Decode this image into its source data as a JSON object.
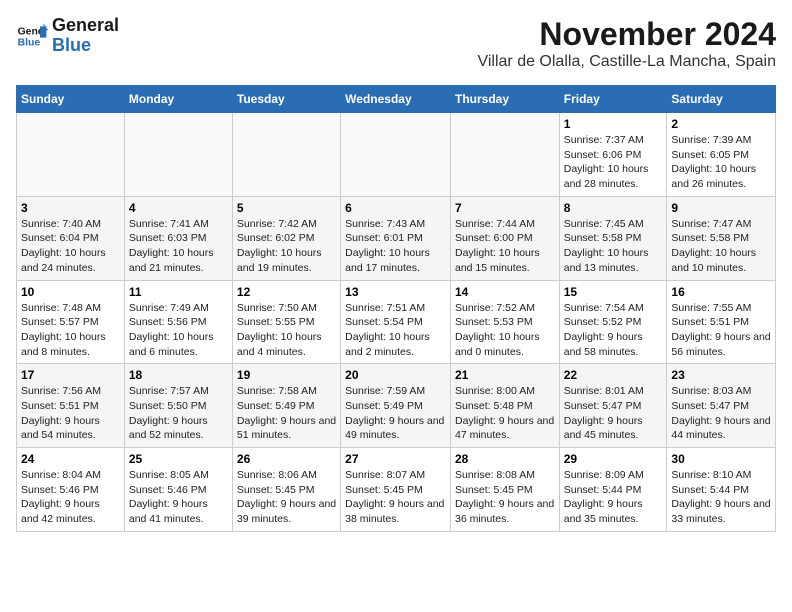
{
  "header": {
    "logo_line1": "General",
    "logo_line2": "Blue",
    "month": "November 2024",
    "location": "Villar de Olalla, Castille-La Mancha, Spain"
  },
  "weekdays": [
    "Sunday",
    "Monday",
    "Tuesday",
    "Wednesday",
    "Thursday",
    "Friday",
    "Saturday"
  ],
  "weeks": [
    [
      {
        "day": "",
        "info": ""
      },
      {
        "day": "",
        "info": ""
      },
      {
        "day": "",
        "info": ""
      },
      {
        "day": "",
        "info": ""
      },
      {
        "day": "",
        "info": ""
      },
      {
        "day": "1",
        "info": "Sunrise: 7:37 AM\nSunset: 6:06 PM\nDaylight: 10 hours and 28 minutes."
      },
      {
        "day": "2",
        "info": "Sunrise: 7:39 AM\nSunset: 6:05 PM\nDaylight: 10 hours and 26 minutes."
      }
    ],
    [
      {
        "day": "3",
        "info": "Sunrise: 7:40 AM\nSunset: 6:04 PM\nDaylight: 10 hours and 24 minutes."
      },
      {
        "day": "4",
        "info": "Sunrise: 7:41 AM\nSunset: 6:03 PM\nDaylight: 10 hours and 21 minutes."
      },
      {
        "day": "5",
        "info": "Sunrise: 7:42 AM\nSunset: 6:02 PM\nDaylight: 10 hours and 19 minutes."
      },
      {
        "day": "6",
        "info": "Sunrise: 7:43 AM\nSunset: 6:01 PM\nDaylight: 10 hours and 17 minutes."
      },
      {
        "day": "7",
        "info": "Sunrise: 7:44 AM\nSunset: 6:00 PM\nDaylight: 10 hours and 15 minutes."
      },
      {
        "day": "8",
        "info": "Sunrise: 7:45 AM\nSunset: 5:58 PM\nDaylight: 10 hours and 13 minutes."
      },
      {
        "day": "9",
        "info": "Sunrise: 7:47 AM\nSunset: 5:58 PM\nDaylight: 10 hours and 10 minutes."
      }
    ],
    [
      {
        "day": "10",
        "info": "Sunrise: 7:48 AM\nSunset: 5:57 PM\nDaylight: 10 hours and 8 minutes."
      },
      {
        "day": "11",
        "info": "Sunrise: 7:49 AM\nSunset: 5:56 PM\nDaylight: 10 hours and 6 minutes."
      },
      {
        "day": "12",
        "info": "Sunrise: 7:50 AM\nSunset: 5:55 PM\nDaylight: 10 hours and 4 minutes."
      },
      {
        "day": "13",
        "info": "Sunrise: 7:51 AM\nSunset: 5:54 PM\nDaylight: 10 hours and 2 minutes."
      },
      {
        "day": "14",
        "info": "Sunrise: 7:52 AM\nSunset: 5:53 PM\nDaylight: 10 hours and 0 minutes."
      },
      {
        "day": "15",
        "info": "Sunrise: 7:54 AM\nSunset: 5:52 PM\nDaylight: 9 hours and 58 minutes."
      },
      {
        "day": "16",
        "info": "Sunrise: 7:55 AM\nSunset: 5:51 PM\nDaylight: 9 hours and 56 minutes."
      }
    ],
    [
      {
        "day": "17",
        "info": "Sunrise: 7:56 AM\nSunset: 5:51 PM\nDaylight: 9 hours and 54 minutes."
      },
      {
        "day": "18",
        "info": "Sunrise: 7:57 AM\nSunset: 5:50 PM\nDaylight: 9 hours and 52 minutes."
      },
      {
        "day": "19",
        "info": "Sunrise: 7:58 AM\nSunset: 5:49 PM\nDaylight: 9 hours and 51 minutes."
      },
      {
        "day": "20",
        "info": "Sunrise: 7:59 AM\nSunset: 5:49 PM\nDaylight: 9 hours and 49 minutes."
      },
      {
        "day": "21",
        "info": "Sunrise: 8:00 AM\nSunset: 5:48 PM\nDaylight: 9 hours and 47 minutes."
      },
      {
        "day": "22",
        "info": "Sunrise: 8:01 AM\nSunset: 5:47 PM\nDaylight: 9 hours and 45 minutes."
      },
      {
        "day": "23",
        "info": "Sunrise: 8:03 AM\nSunset: 5:47 PM\nDaylight: 9 hours and 44 minutes."
      }
    ],
    [
      {
        "day": "24",
        "info": "Sunrise: 8:04 AM\nSunset: 5:46 PM\nDaylight: 9 hours and 42 minutes."
      },
      {
        "day": "25",
        "info": "Sunrise: 8:05 AM\nSunset: 5:46 PM\nDaylight: 9 hours and 41 minutes."
      },
      {
        "day": "26",
        "info": "Sunrise: 8:06 AM\nSunset: 5:45 PM\nDaylight: 9 hours and 39 minutes."
      },
      {
        "day": "27",
        "info": "Sunrise: 8:07 AM\nSunset: 5:45 PM\nDaylight: 9 hours and 38 minutes."
      },
      {
        "day": "28",
        "info": "Sunrise: 8:08 AM\nSunset: 5:45 PM\nDaylight: 9 hours and 36 minutes."
      },
      {
        "day": "29",
        "info": "Sunrise: 8:09 AM\nSunset: 5:44 PM\nDaylight: 9 hours and 35 minutes."
      },
      {
        "day": "30",
        "info": "Sunrise: 8:10 AM\nSunset: 5:44 PM\nDaylight: 9 hours and 33 minutes."
      }
    ]
  ]
}
